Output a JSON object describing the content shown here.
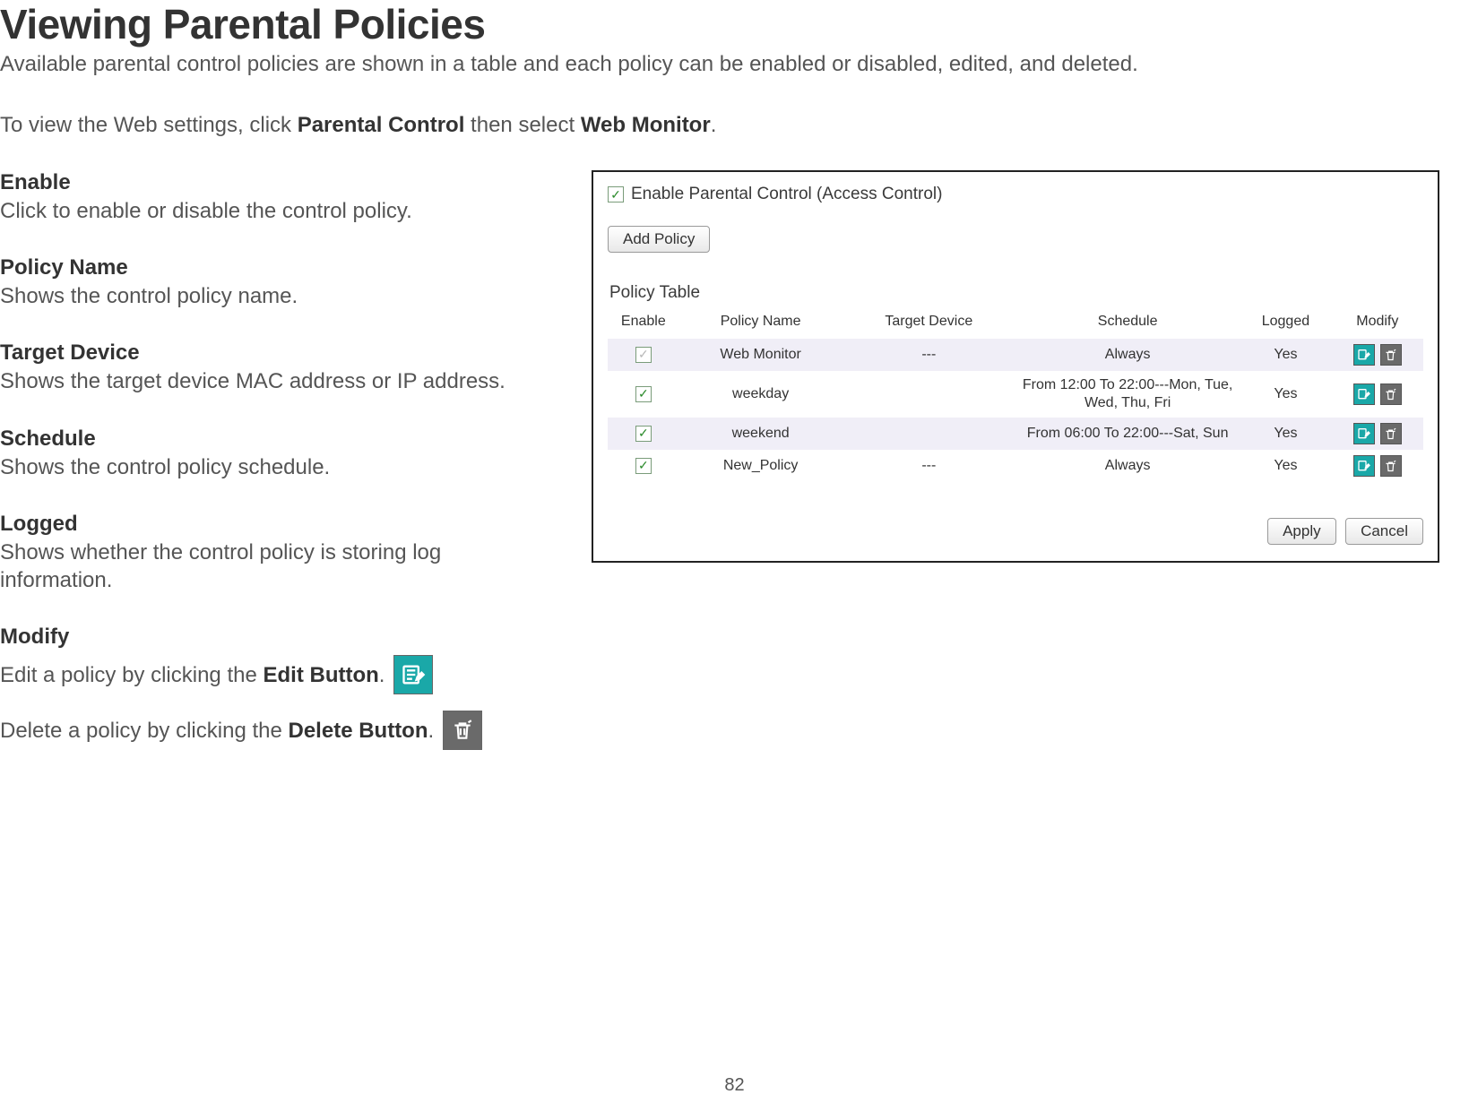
{
  "page": {
    "title": "Viewing Parental Policies",
    "intro": "Available parental control policies are shown in a table and each policy can be enabled or disabled, edited, and deleted.",
    "sub_intro_pre": "To view the Web settings, click ",
    "sub_intro_bold1": "Parental Control",
    "sub_intro_mid": " then select ",
    "sub_intro_bold2": "Web Monitor",
    "sub_intro_post": ".",
    "page_number": "82"
  },
  "definitions": {
    "enable": {
      "term": "Enable",
      "desc": "Click to enable or disable the control policy."
    },
    "policy_name": {
      "term": "Policy Name",
      "desc": "Shows the control policy name."
    },
    "target_device": {
      "term": "Target Device",
      "desc": "Shows the target device MAC address or IP address."
    },
    "schedule": {
      "term": "Schedule",
      "desc": "Shows the control policy schedule."
    },
    "logged": {
      "term": "Logged",
      "desc": "Shows whether the control policy is storing log information."
    },
    "modify": {
      "term": "Modify",
      "edit_pre": "Edit a policy by clicking the ",
      "edit_bold": "Edit Button",
      "edit_post": ".",
      "delete_pre": "Delete a policy by clicking the ",
      "delete_bold": "Delete Button",
      "delete_post": "."
    }
  },
  "panel": {
    "enable_label": "Enable Parental Control (Access Control)",
    "add_policy": "Add Policy",
    "table_title": "Policy Table",
    "headers": {
      "enable": "Enable",
      "policy_name": "Policy Name",
      "target_device": "Target Device",
      "schedule": "Schedule",
      "logged": "Logged",
      "modify": "Modify"
    },
    "rows": [
      {
        "enabled_disabled": true,
        "policy_name": "Web Monitor",
        "target_device": "---",
        "schedule": "Always",
        "logged": "Yes"
      },
      {
        "enabled_disabled": false,
        "policy_name": "weekday",
        "target_device": "",
        "schedule": "From 12:00 To 22:00---Mon, Tue, Wed, Thu, Fri",
        "logged": "Yes"
      },
      {
        "enabled_disabled": false,
        "policy_name": "weekend",
        "target_device": "",
        "schedule": "From 06:00 To 22:00---Sat, Sun",
        "logged": "Yes"
      },
      {
        "enabled_disabled": false,
        "policy_name": "New_Policy",
        "target_device": "---",
        "schedule": "Always",
        "logged": "Yes"
      }
    ],
    "apply": "Apply",
    "cancel": "Cancel"
  },
  "icons": {
    "check": "✓",
    "edit": "edit-icon",
    "delete": "trash-icon"
  },
  "colors": {
    "teal": "#1aa8a8",
    "gray_icon": "#6a6a6a"
  }
}
